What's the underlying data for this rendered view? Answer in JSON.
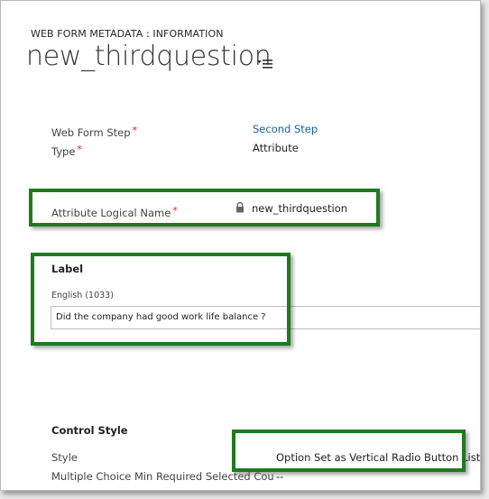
{
  "header": {
    "entity_label": "WEB FORM METADATA : INFORMATION",
    "record_title": "new_thirdquestion"
  },
  "fields": {
    "web_form_step": {
      "label": "Web Form Step",
      "required_mark": "*",
      "value": "Second Step"
    },
    "type": {
      "label": "Type",
      "required_mark": "*",
      "value": "Attribute"
    },
    "attribute_logical_name": {
      "label": "Attribute Logical Name",
      "required_mark": "*",
      "value": "new_thirdquestion",
      "icon": "lock-icon"
    }
  },
  "label_section": {
    "heading": "Label",
    "language": "English (1033)",
    "value": "Did the company had good work life balance ?"
  },
  "control_style_section": {
    "heading": "Control Style",
    "style_label": "Style",
    "style_value": "Option Set as Vertical Radio Button List",
    "multiple_choice_label": "Multiple Choice Min Required Selected Cou",
    "multiple_choice_value": "--"
  },
  "colors": {
    "highlight": "#1e7a1e",
    "link": "#1160b7",
    "required": "#e0161b"
  }
}
